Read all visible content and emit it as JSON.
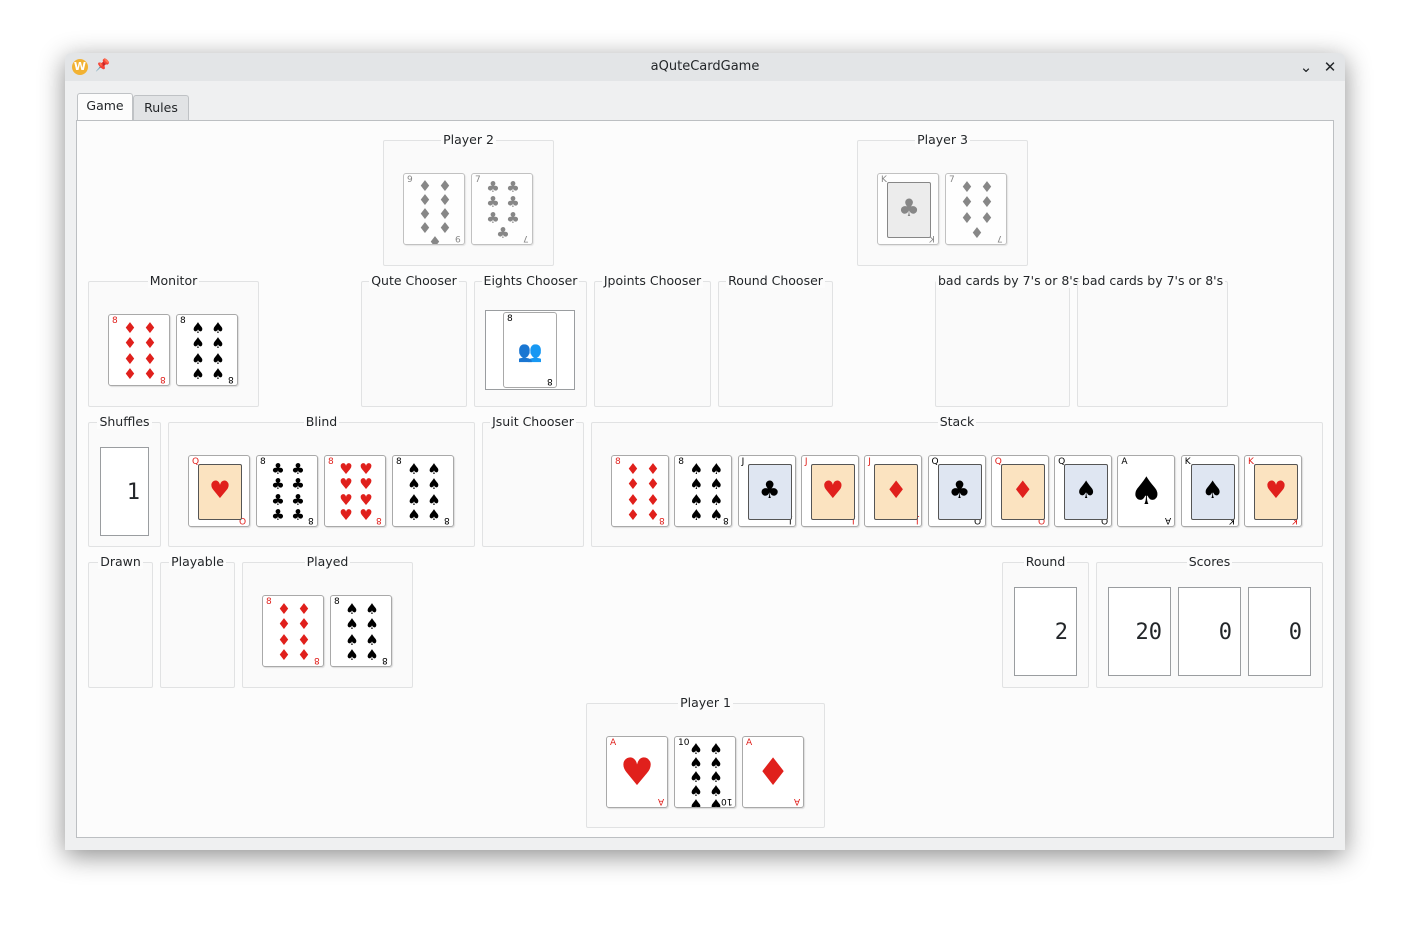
{
  "window": {
    "title": "aQuteCardGame",
    "app_icon": "W"
  },
  "tabs": [
    {
      "label": "Game"
    },
    {
      "label": "Rules"
    }
  ],
  "groups": {
    "player2": "Player 2",
    "player3": "Player 3",
    "monitor": "Monitor",
    "qute_chooser": "Qute Chooser",
    "eights_chooser": "Eights Chooser",
    "jpoints_chooser": "Jpoints Chooser",
    "round_chooser": "Round Chooser",
    "bad_cards_1": "bad cards by 7's or 8's",
    "bad_cards_2": "bad cards by 7's or 8's",
    "shuffles": "Shuffles",
    "blind": "Blind",
    "jsuit_chooser": "Jsuit Chooser",
    "stack": "Stack",
    "drawn": "Drawn",
    "playable": "Playable",
    "played": "Played",
    "round": "Round",
    "scores": "Scores",
    "player1": "Player 1"
  },
  "cards": {
    "player2": [
      {
        "rank": "9",
        "suit": "♦",
        "color": "#555555"
      },
      {
        "rank": "7",
        "suit": "♣",
        "color": "#555555"
      }
    ],
    "player3": [
      {
        "rank": "K",
        "suit": "♣",
        "color": "#555555"
      },
      {
        "rank": "7",
        "suit": "♦",
        "color": "#555555"
      }
    ],
    "monitor": [
      {
        "rank": "8",
        "suit": "♦",
        "color": "#e0201c"
      },
      {
        "rank": "8",
        "suit": "♠",
        "color": "#000000"
      }
    ],
    "eights_chooser": [
      {
        "rank": "8"
      }
    ],
    "blind": [
      {
        "rank": "Q",
        "suit": "♥",
        "color": "#e0201c"
      },
      {
        "rank": "8",
        "suit": "♣",
        "color": "#000000"
      },
      {
        "rank": "8",
        "suit": "♥",
        "color": "#e0201c"
      },
      {
        "rank": "8",
        "suit": "♠",
        "color": "#000000"
      }
    ],
    "stack": [
      {
        "rank": "8",
        "suit": "♦",
        "color": "#e0201c"
      },
      {
        "rank": "8",
        "suit": "♠",
        "color": "#000000"
      },
      {
        "rank": "J",
        "suit": "♣",
        "color": "#000000"
      },
      {
        "rank": "J",
        "suit": "♥",
        "color": "#e0201c"
      },
      {
        "rank": "J",
        "suit": "♦",
        "color": "#e0201c"
      },
      {
        "rank": "Q",
        "suit": "♣",
        "color": "#000000"
      },
      {
        "rank": "Q",
        "suit": "♦",
        "color": "#e0201c"
      },
      {
        "rank": "Q",
        "suit": "♠",
        "color": "#000000"
      },
      {
        "rank": "A",
        "suit": "♠",
        "color": "#000000"
      },
      {
        "rank": "K",
        "suit": "♠",
        "color": "#000000"
      },
      {
        "rank": "K",
        "suit": "♥",
        "color": "#e0201c"
      }
    ],
    "played": [
      {
        "rank": "8",
        "suit": "♦",
        "color": "#e0201c"
      },
      {
        "rank": "8",
        "suit": "♠",
        "color": "#000000"
      }
    ],
    "player1": [
      {
        "rank": "A",
        "suit": "♥",
        "color": "#e0201c"
      },
      {
        "rank": "10",
        "suit": "♠",
        "color": "#000000"
      },
      {
        "rank": "A",
        "suit": "♦",
        "color": "#e0201c"
      }
    ]
  },
  "shuffles_value": "1",
  "round_value": "2",
  "scores": [
    "20",
    "0",
    "0"
  ]
}
